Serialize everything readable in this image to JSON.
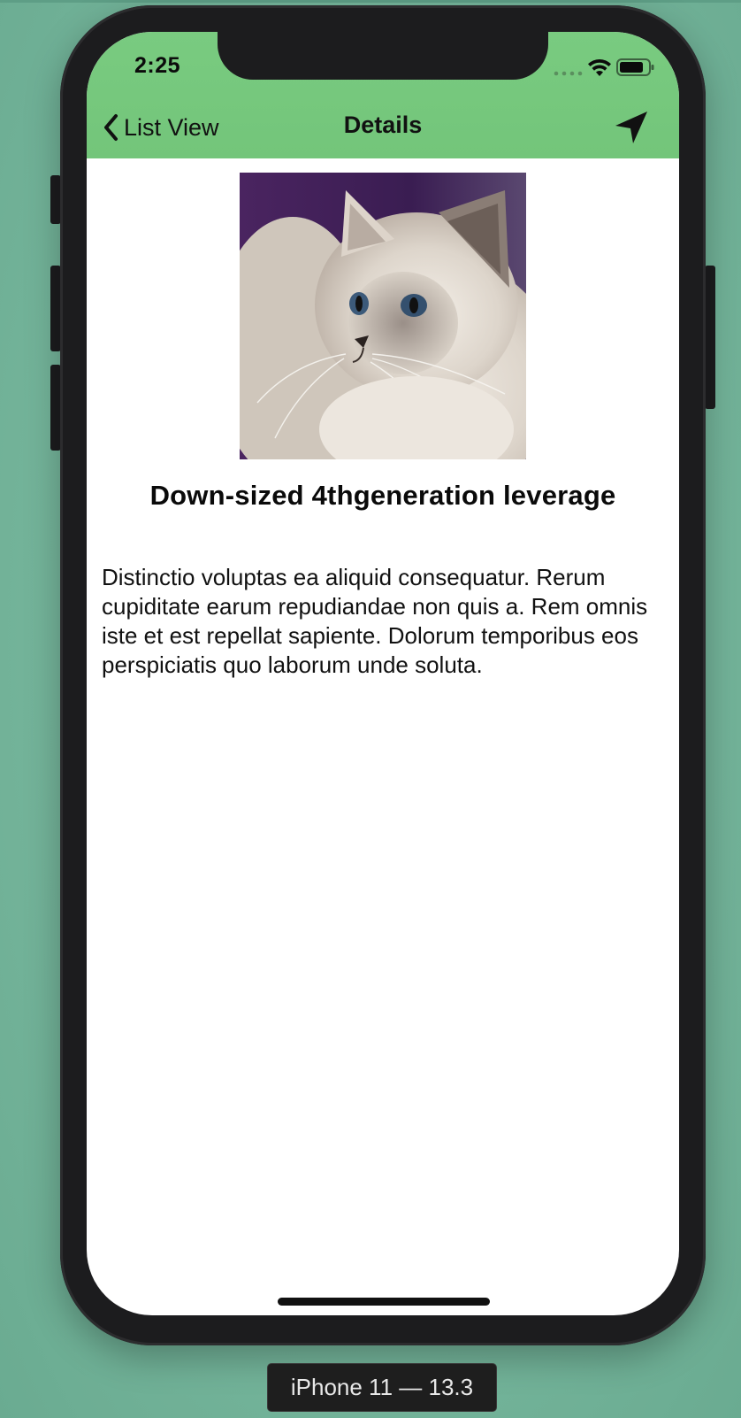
{
  "status_bar": {
    "time": "2:25",
    "icons": [
      "signal-icon",
      "wifi-icon",
      "battery-icon"
    ]
  },
  "nav_bar": {
    "back_label": "List View",
    "title": "Details",
    "right_icon": "location-arrow-icon",
    "background_color": "#73c57a"
  },
  "content": {
    "image_subject": "cat",
    "headline": "Down-sized 4thgeneration leverage",
    "body": "Distinctio voluptas ea aliquid consequatur. Rerum cupiditate earum repudiandae non quis a. Rem omnis iste et est repellat sapiente. Dolorum temporibus eos perspiciatis quo laborum unde soluta."
  },
  "simulator": {
    "device_label": "iPhone 11 — 13.3"
  }
}
